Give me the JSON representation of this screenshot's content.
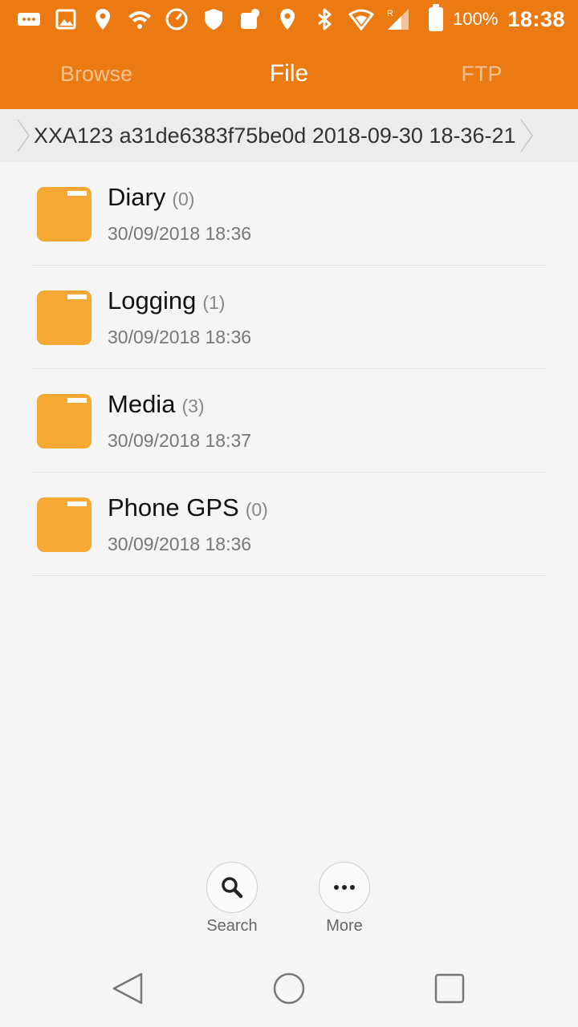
{
  "status_bar": {
    "icons": [
      "message-icon",
      "image-icon",
      "location-icon",
      "wifi-icon",
      "speedometer-icon",
      "shield-icon",
      "map-icon",
      "location-icon",
      "bluetooth-icon",
      "wifi-signal-icon",
      "cellular-signal-icon"
    ],
    "signal_roaming": "R",
    "battery_percent": "100%",
    "time": "18:38"
  },
  "tabs": [
    {
      "label": "Browse",
      "active": false
    },
    {
      "label": "File",
      "active": true
    },
    {
      "label": "FTP",
      "active": false
    }
  ],
  "breadcrumb": {
    "path": "XXA123 a31de6383f75be0d 2018-09-30 18-36-21"
  },
  "items": [
    {
      "name": "Diary",
      "count": "(0)",
      "date": "30/09/2018 18:36"
    },
    {
      "name": "Logging",
      "count": "(1)",
      "date": "30/09/2018 18:36"
    },
    {
      "name": "Media",
      "count": "(3)",
      "date": "30/09/2018 18:37"
    },
    {
      "name": "Phone GPS",
      "count": "(0)",
      "date": "30/09/2018 18:36"
    }
  ],
  "actions": {
    "search_label": "Search",
    "more_label": "More"
  },
  "colors": {
    "header": "#eb7a12",
    "folder": "#f5a833",
    "background": "#f5f5f5"
  }
}
